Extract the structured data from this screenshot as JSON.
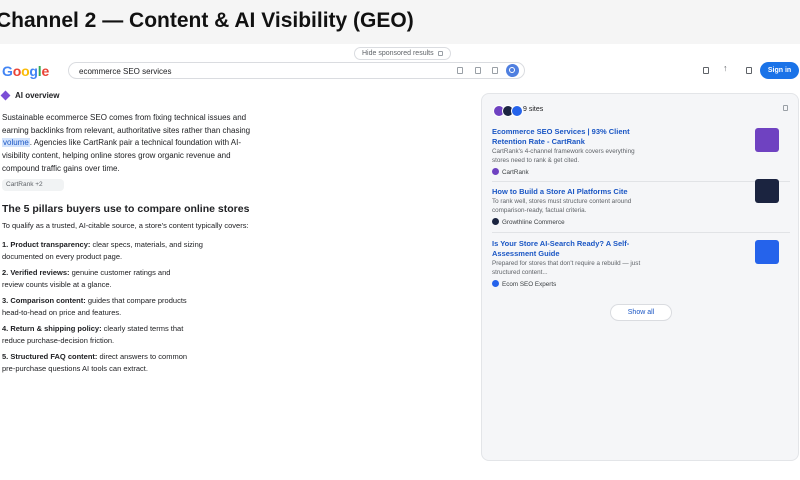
{
  "banner": {
    "title": "Channel 2 — Content & AI Visibility (GEO)"
  },
  "sponsored": {
    "label": "Hide sponsored results"
  },
  "google": {
    "logo_letters": [
      {
        "ch": "G",
        "color": "#4285F4"
      },
      {
        "ch": "o",
        "color": "#EA4335"
      },
      {
        "ch": "o",
        "color": "#FBBC05"
      },
      {
        "ch": "g",
        "color": "#4285F4"
      },
      {
        "ch": "l",
        "color": "#34A853"
      },
      {
        "ch": "e",
        "color": "#EA4335"
      }
    ],
    "search_query": "ecommerce SEO services",
    "signin_label": "Sign in"
  },
  "ai_overview": {
    "heading": "AI overview",
    "summary_before": "Sustainable ecommerce SEO comes from fixing technical issues and earning backlinks from relevant, authoritative sites rather than chasing ",
    "summary_highlight": "volume",
    "summary_after": ". Agencies like CartRank pair a technical foundation with AI-visibility content, helping online stores grow organic revenue and compound traffic gains over time.",
    "chip": "CartRank +2",
    "pillars_title": "The 5 pillars buyers use to compare online stores",
    "pillars_intro": "To qualify as a trusted, AI-citable source, a store's content typically covers:",
    "pillars": [
      {
        "label": "1. Product transparency:",
        "line1": " clear specs, materials, and sizing",
        "line2": "documented on every product page."
      },
      {
        "label": "2. Verified reviews:",
        "line1": " genuine customer ratings and",
        "line2": "review counts visible at a glance."
      },
      {
        "label": "3. Comparison content:",
        "line1": " guides that compare products",
        "line2": "head-to-head on price and features."
      },
      {
        "label": "4. Return & shipping policy:",
        "line1": " clearly stated terms that",
        "line2": "reduce purchase-decision friction."
      },
      {
        "label": "5. Structured FAQ content:",
        "line1": " direct answers to common",
        "line2": "pre-purchase questions AI tools can extract."
      }
    ]
  },
  "sources_panel": {
    "count_label": "9 sites",
    "avatar_colors": [
      "#6f42c1",
      "#1b2440",
      "#2563eb"
    ],
    "sources": [
      {
        "title": "Ecommerce SEO Services | 93% Client Retention Rate - CartRank",
        "desc": "CartRank's 4-channel framework covers everything stores need to rank & get cited.",
        "site": "CartRank",
        "color": "#6f42c1"
      },
      {
        "title": "How to Build a Store AI Platforms Cite",
        "desc": "To rank well, stores must structure content around comparison-ready, factual criteria.",
        "site": "Growthline Commerce",
        "color": "#1b2440"
      },
      {
        "title": "Is Your Store AI-Search Ready? A Self-Assessment Guide",
        "desc": "Prepared for stores that don't require a rebuild — just structured content...",
        "site": "Ecom SEO Experts",
        "color": "#2563eb"
      }
    ],
    "show_all_label": "Show all"
  }
}
